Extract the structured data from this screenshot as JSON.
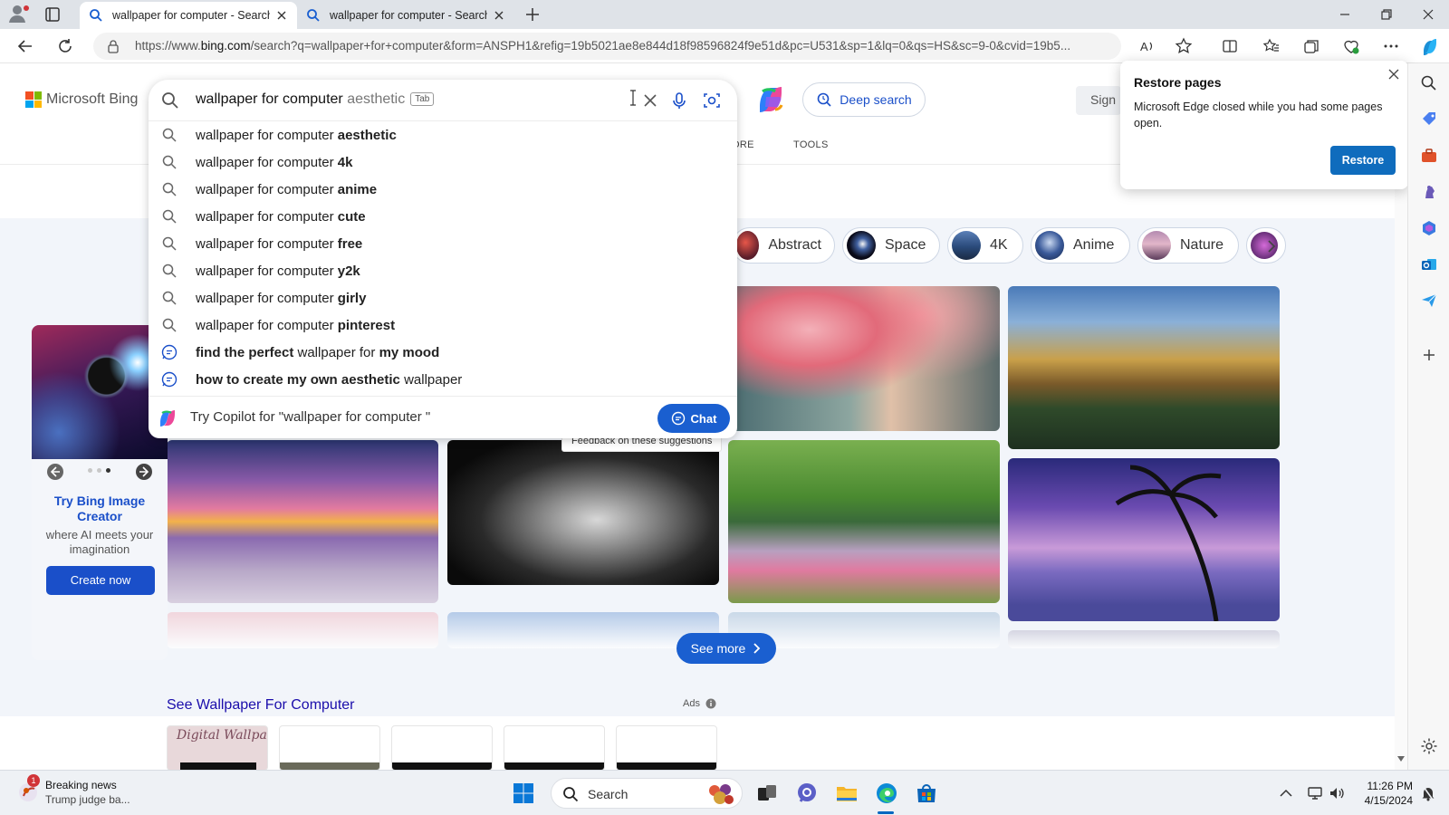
{
  "browser": {
    "tabs": [
      {
        "title": "wallpaper for computer - Search",
        "active": true
      },
      {
        "title": "wallpaper for computer - Search",
        "active": false
      }
    ],
    "url_prefix": "https://www.",
    "url_domain": "bing.com",
    "url_rest": "/search?q=wallpaper+for+computer&form=ANSPH1&refig=19b5021ae8e844d18f98596824f9e51d&pc=U531&sp=1&lq=0&qs=HS&sc=9-0&cvid=19b5..."
  },
  "header": {
    "logo_text": "Microsoft Bing",
    "deep_search_label": "Deep search",
    "sign_in_label": "Sign",
    "nav_more": "ORE",
    "nav_tools": "TOOLS"
  },
  "search": {
    "typed": "wallpaper for computer",
    "ghost_completion": " aesthetic",
    "tab_hint": "Tab",
    "suggestions": [
      {
        "prefix": "wallpaper for computer ",
        "bold": "aesthetic"
      },
      {
        "prefix": "wallpaper for computer ",
        "bold": "4k"
      },
      {
        "prefix": "wallpaper for computer ",
        "bold": "anime"
      },
      {
        "prefix": "wallpaper for computer ",
        "bold": "cute"
      },
      {
        "prefix": "wallpaper for computer ",
        "bold": "free"
      },
      {
        "prefix": "wallpaper for computer ",
        "bold": "y2k"
      },
      {
        "prefix": "wallpaper for computer ",
        "bold": "girly"
      },
      {
        "prefix": "wallpaper for computer ",
        "bold": "pinterest"
      }
    ],
    "chat_suggestions": [
      {
        "b1": "find the perfect",
        "mid": " wallpaper for ",
        "b2": "my mood"
      },
      {
        "b1": "how to create my own aesthetic",
        "mid": " wallpaper",
        "b2": ""
      }
    ],
    "copilot_prompt": "Try Copilot for \"wallpaper for computer \"",
    "chat_label": "Chat",
    "feedback_label": "Feedback on these suggestions"
  },
  "chips": [
    "Abstract",
    "Space",
    "4K",
    "Anime",
    "Nature"
  ],
  "promo": {
    "title": "Try Bing Image Creator",
    "subtitle": "where AI meets your imagination",
    "button": "Create now"
  },
  "see_more_label": "See more",
  "ads": {
    "title": "See Wallpaper For Computer",
    "label": "Ads",
    "first_thumb_text": "Digital Wallpaper"
  },
  "restore_popup": {
    "title": "Restore pages",
    "body": "Microsoft Edge closed while you had some pages open.",
    "button": "Restore"
  },
  "taskbar": {
    "news_badge": "1",
    "news_title": "Breaking news",
    "news_sub": "Trump judge ba...",
    "search_label": "Search",
    "time": "11:26 PM",
    "date": "4/15/2024"
  },
  "colors": {
    "accent": "#1a5fd0",
    "link": "#1a0dab",
    "restore_button": "#0f6cbd"
  }
}
